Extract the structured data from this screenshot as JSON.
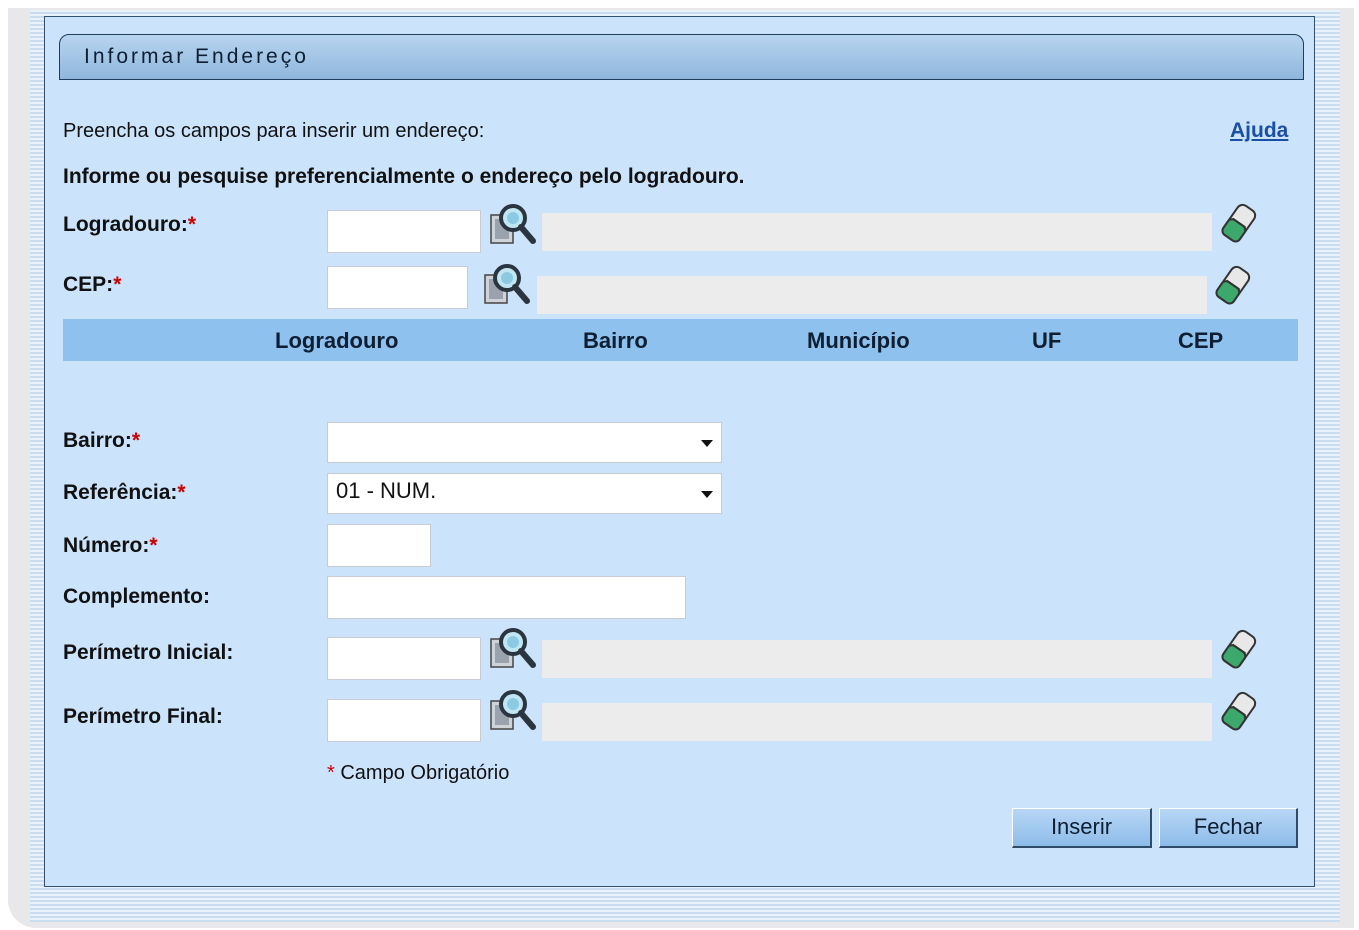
{
  "title": "Informar Endereço",
  "intro": "Preencha os campos para inserir um endereço:",
  "help_link": "Ajuda",
  "instruction": "Informe ou pesquise preferencialmente o endereço pelo logradouro.",
  "required_mark": "*",
  "fields": {
    "logradouro": {
      "label": "Logradouro:",
      "value": "",
      "description": ""
    },
    "cep": {
      "label": "CEP:",
      "value": "",
      "description": ""
    },
    "bairro": {
      "label": "Bairro:",
      "selected": ""
    },
    "referencia": {
      "label": "Referência:",
      "selected": "01 - NUM."
    },
    "numero": {
      "label": "Número:",
      "value": ""
    },
    "complemento": {
      "label": "Complemento:",
      "value": ""
    },
    "perimetro_inicial": {
      "label": "Perímetro Inicial:",
      "value": "",
      "description": ""
    },
    "perimetro_final": {
      "label": "Perímetro Final:",
      "value": "",
      "description": ""
    }
  },
  "table": {
    "columns": [
      "Logradouro",
      "Bairro",
      "Município",
      "UF",
      "CEP"
    ]
  },
  "required_note": "Campo Obrigatório",
  "buttons": {
    "insert": "Inserir",
    "close": "Fechar"
  },
  "icons": {
    "search": "magnifier-search-icon",
    "clear": "eraser-icon"
  },
  "colors": {
    "panel_bg": "#cbe3fb",
    "table_header_bg": "#8fc1ef",
    "required": "#cc0000",
    "link": "#1a4fa3"
  }
}
